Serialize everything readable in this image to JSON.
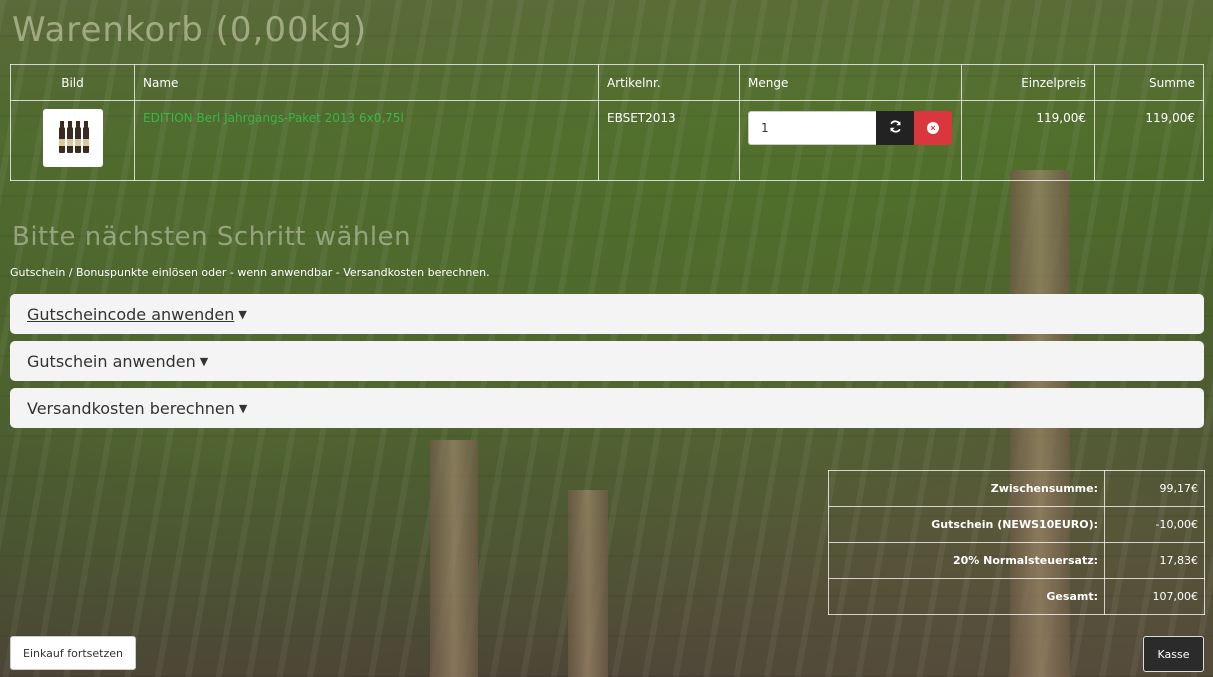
{
  "cart": {
    "title": "Warenkorb (0,00kg)",
    "columns": {
      "image": "Bild",
      "name": "Name",
      "sku": "Artikelnr.",
      "qty": "Menge",
      "unit_price": "Einzelpreis",
      "sum": "Summe"
    },
    "items": [
      {
        "name": "EDITION Berl Jahrgangs-Paket 2013 6x0,75l",
        "sku": "EBSET2013",
        "qty": "1",
        "unit_price": "119,00€",
        "sum": "119,00€",
        "image_icon": "wine-bottles-image"
      }
    ]
  },
  "step": {
    "title": "Bitte nächsten Schritt wählen",
    "description": "Gutschein / Bonuspunkte einlösen oder - wenn anwendbar - Versandkosten berechnen."
  },
  "accordions": [
    {
      "label": "Gutscheincode anwenden"
    },
    {
      "label": "Gutschein anwenden"
    },
    {
      "label": "Versandkosten berechnen"
    }
  ],
  "totals": [
    {
      "label": "Zwischensumme:",
      "value": "99,17€"
    },
    {
      "label": "Gutschein (NEWS10EURO):",
      "value": "-10,00€"
    },
    {
      "label": "20% Normalsteuersatz:",
      "value": "17,83€"
    },
    {
      "label": "Gesamt:",
      "value": "107,00€"
    }
  ],
  "buttons": {
    "continue": "Einkauf fortsetzen",
    "checkout": "Kasse"
  },
  "colors": {
    "link": "#3cb54a",
    "delete": "#d9363e",
    "refresh": "#222222"
  }
}
